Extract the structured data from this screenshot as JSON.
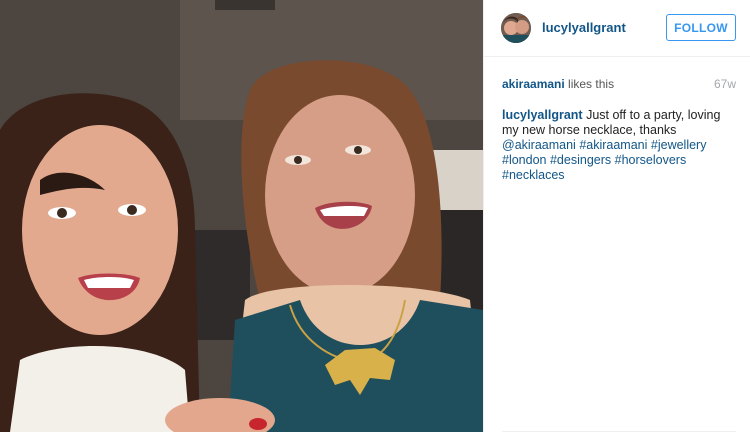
{
  "post": {
    "photo_alt": "",
    "author": {
      "username": "lucylyallgrant"
    },
    "follow_label": "FOLLOW",
    "likes": {
      "liker": "akiraamani",
      "suffix": " likes this",
      "time_ago": "67w"
    },
    "caption": {
      "username": "lucylyallgrant",
      "text": " Just off to a party, loving my new horse necklace, thanks ",
      "mention": "@akiraamani",
      "hashtags": [
        "#akiraamani",
        "#jewellery",
        "#london",
        "#desingers",
        "#horselovers",
        "#necklaces"
      ]
    }
  },
  "colors": {
    "link": "#125688",
    "follow_blue": "#3897f0",
    "muted": "#a5a7aa"
  }
}
